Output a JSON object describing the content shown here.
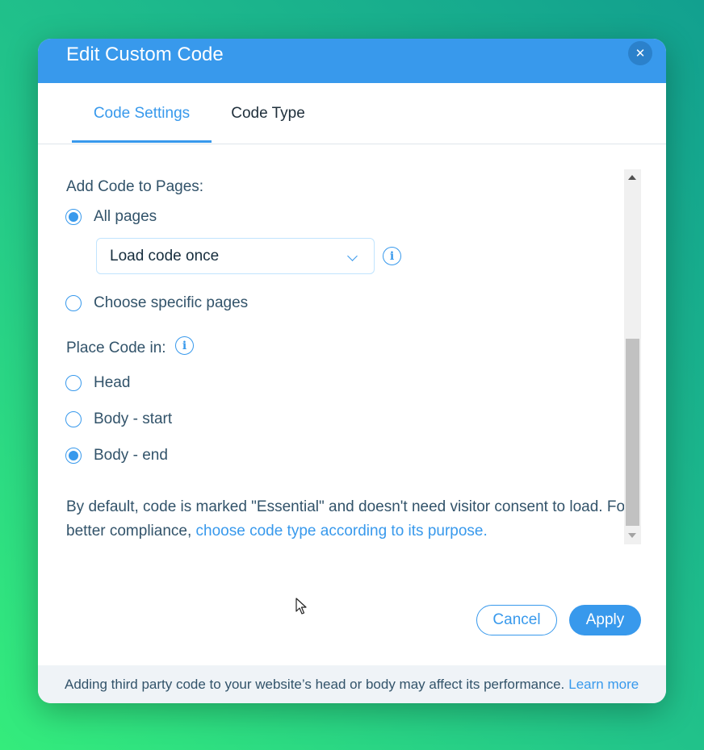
{
  "dialog": {
    "title": "Edit Custom Code",
    "close_icon": "close-icon"
  },
  "tabs": [
    {
      "label": "Code Settings",
      "active": true
    },
    {
      "label": "Code Type",
      "active": false
    }
  ],
  "pages_section": {
    "label": "Add Code to Pages:",
    "options": [
      {
        "label": "All pages",
        "checked": true
      },
      {
        "label": "Choose specific pages",
        "checked": false
      }
    ],
    "load_dropdown": {
      "selected": "Load code once",
      "icon": "chevron-down-icon"
    },
    "info_icon": "info-icon"
  },
  "placement_section": {
    "label": "Place Code in:",
    "info_icon": "info-icon",
    "options": [
      {
        "label": "Head",
        "checked": false
      },
      {
        "label": "Body - start",
        "checked": false
      },
      {
        "label": "Body - end",
        "checked": true
      }
    ]
  },
  "notice": {
    "text": "By default, code is marked \"Essential\" and doesn't need visitor consent to load. For better compliance, ",
    "link": "choose code type according to its purpose."
  },
  "actions": {
    "cancel_label": "Cancel",
    "apply_label": "Apply"
  },
  "footer": {
    "text": "Adding third party code to your website’s head or body may affect its performance.",
    "link": "Learn more"
  },
  "colors": {
    "accent": "#3899ec",
    "text": "#32536a",
    "footer_bg": "#eff3f7"
  }
}
